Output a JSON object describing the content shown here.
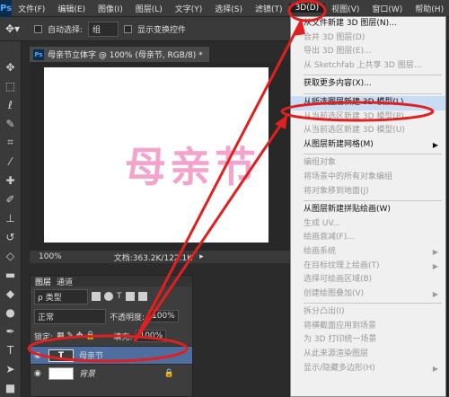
{
  "menubar": {
    "logo": "Ps",
    "items": [
      "文件(F)",
      "编辑(E)",
      "图像(I)",
      "图层(L)",
      "文字(Y)",
      "选择(S)",
      "滤镜(T)",
      "3D(D)",
      "视图(V)",
      "窗口(W)",
      "帮助(H)"
    ],
    "active_index": 7,
    "window_buttons": [
      "—",
      "□",
      "✕"
    ]
  },
  "options_bar": {
    "auto_select_label": "自动选择:",
    "auto_select_value": "组",
    "show_transform_label": "显示变换控件"
  },
  "document": {
    "tab_title": "母亲节立体字 @ 100% (母亲节, RGB/8) *",
    "canvas_text": "母亲节",
    "zoom": "100%",
    "doc_size": "文档:363.2K/122.1K"
  },
  "layers_panel": {
    "tabs": [
      "图层",
      "通道"
    ],
    "kind_label": "ρ 类型",
    "blend_mode": "正常",
    "opacity_label": "不透明度:",
    "opacity_value": "100%",
    "lock_label": "锁定:",
    "fill_label": "填充:",
    "fill_value": "100%",
    "layers": [
      {
        "name": "母亲节",
        "thumb": "T",
        "selected": true
      },
      {
        "name": "背景",
        "thumb": "",
        "selected": false
      }
    ]
  },
  "dropdown_3d": {
    "items": [
      {
        "label": "从文件新建 3D 图层(N)...",
        "disabled": false
      },
      {
        "label": "合并 3D 图层(D)",
        "disabled": true
      },
      {
        "label": "导出 3D 图层(E)...",
        "disabled": true
      },
      {
        "label": "从 Sketchfab 上共享 3D 图层...",
        "disabled": true
      },
      {
        "sep": true
      },
      {
        "label": "获取更多内容(X)...",
        "disabled": false
      },
      {
        "sep": true
      },
      {
        "label": "从所选图层新建 3D 模型(L)",
        "disabled": false,
        "highlight": true
      },
      {
        "label": "从当前选区新建 3D 模型(P)",
        "disabled": true
      },
      {
        "label": "从当前选区新建 3D 模型(U)",
        "disabled": true
      },
      {
        "label": "从图层新建网格(M)",
        "disabled": false,
        "submenu": true
      },
      {
        "sep": true
      },
      {
        "label": "编组对象",
        "disabled": true
      },
      {
        "label": "将场景中的所有对象编组",
        "disabled": true
      },
      {
        "label": "将对象移到地面(J)",
        "disabled": true
      },
      {
        "sep": true
      },
      {
        "label": "从图层新建拼贴绘画(W)",
        "disabled": false
      },
      {
        "label": "生成 UV...",
        "disabled": true
      },
      {
        "label": "绘画衰减(F)...",
        "disabled": true
      },
      {
        "label": "绘画系统",
        "disabled": true,
        "submenu": true
      },
      {
        "label": "在目标纹理上绘画(T)",
        "disabled": true,
        "submenu": true
      },
      {
        "label": "选择可绘画区域(B)",
        "disabled": true
      },
      {
        "label": "创建绘图叠加(V)",
        "disabled": true,
        "submenu": true
      },
      {
        "sep": true
      },
      {
        "label": "拆分凸出(I)",
        "disabled": true
      },
      {
        "label": "将横截面应用到场景",
        "disabled": true
      },
      {
        "label": "为 3D 打印统一场景",
        "disabled": true
      },
      {
        "label": "从此来源渲染图层",
        "disabled": true
      },
      {
        "label": "显示/隐藏多边形(H)",
        "disabled": true,
        "submenu": true
      }
    ]
  },
  "colors": {
    "accent_red": "#e02020",
    "canvas_text": "#f4a3cc",
    "highlight": "#c9dcf5"
  }
}
